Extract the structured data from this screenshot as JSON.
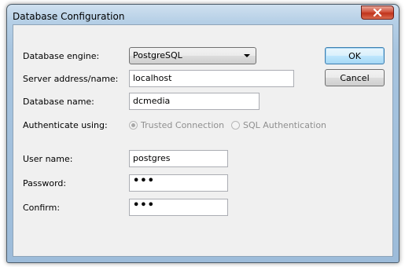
{
  "window": {
    "title": "Database Configuration",
    "close_glyph": "✕"
  },
  "form": {
    "engine_label": "Database engine:",
    "engine_value": "PostgreSQL",
    "server_label": "Server address/name:",
    "server_value": "localhost",
    "dbname_label": "Database name:",
    "dbname_value": "dcmedia",
    "auth_label": "Authenticate using:",
    "auth_options": [
      {
        "label": "Trusted Connection",
        "selected": true
      },
      {
        "label": "SQL Authentication",
        "selected": false
      }
    ],
    "username_label": "User name:",
    "username_value": "postgres",
    "password_label": "Password:",
    "password_value": "•••",
    "confirm_label": "Confirm:",
    "confirm_value": "•••"
  },
  "buttons": {
    "ok_label": "OK",
    "cancel_label": "Cancel"
  },
  "icons": {
    "close": "close-icon",
    "dropdown": "chevron-down-icon"
  },
  "colors": {
    "frame": "#a7c4df",
    "close_button": "#c0341c",
    "client_bg": "#f0f0f0",
    "disabled_text": "#8f8f8f"
  }
}
